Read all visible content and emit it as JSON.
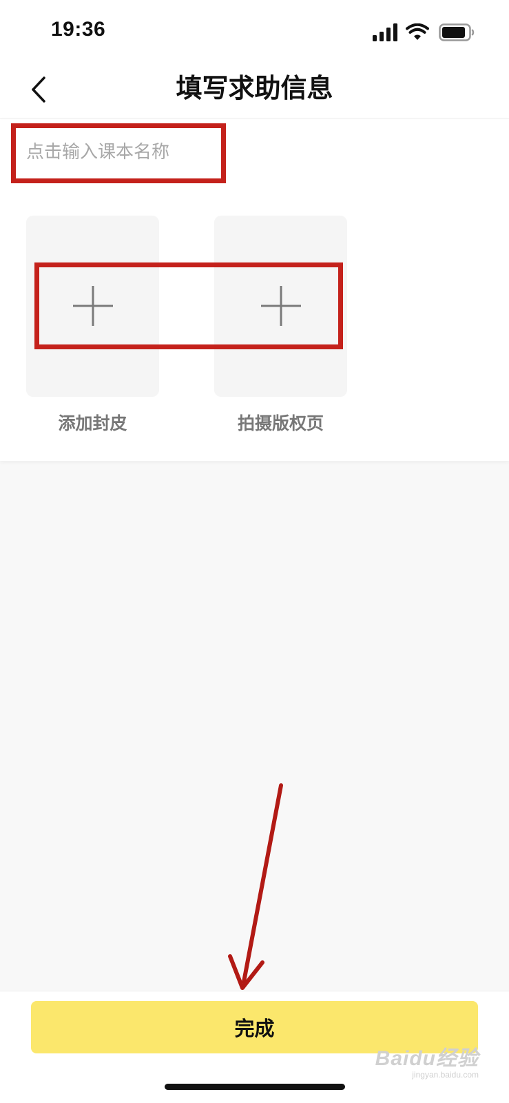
{
  "status_bar": {
    "time": "19:36",
    "icons": [
      "signal-icon",
      "wifi-icon",
      "battery-icon"
    ]
  },
  "nav": {
    "title": "填写求助信息",
    "back_icon": "chevron-left-icon"
  },
  "form": {
    "name_placeholder": "点击输入课本名称",
    "name_value": "",
    "uploads": [
      {
        "label": "添加封皮",
        "icon": "plus-icon"
      },
      {
        "label": "拍摄版权页",
        "icon": "plus-icon"
      }
    ]
  },
  "footer": {
    "done_label": "完成"
  },
  "watermark": {
    "main": "Baidu经验",
    "sub": "jingyan.baidu.com"
  },
  "colors": {
    "accent": "#fbe76c",
    "annotation": "#c4211b"
  }
}
